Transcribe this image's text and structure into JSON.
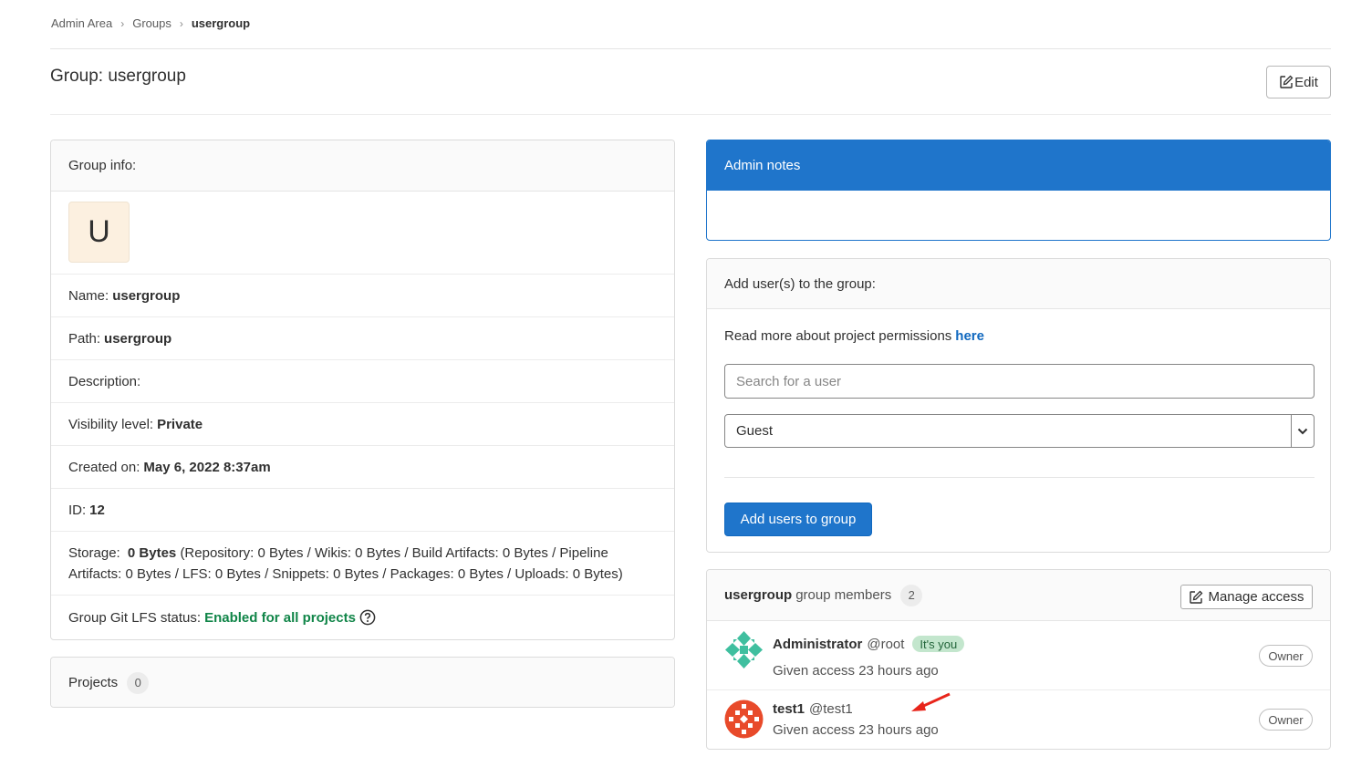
{
  "breadcrumb": {
    "items": [
      "Admin Area",
      "Groups"
    ],
    "current": "usergroup"
  },
  "header": {
    "title": "Group: usergroup",
    "edit_label": "Edit",
    "edit_icon": "pencil-square-icon"
  },
  "group_info": {
    "header": "Group info:",
    "avatar_letter": "U",
    "name_label": "Name:",
    "name_value": "usergroup",
    "path_label": "Path:",
    "path_value": "usergroup",
    "description_label": "Description:",
    "visibility_label": "Visibility level:",
    "visibility_value": "Private",
    "created_label": "Created on:",
    "created_value": "May 6, 2022 8:37am",
    "id_label": "ID:",
    "id_value": "12",
    "storage_label": "Storage:",
    "storage_value": "0 Bytes",
    "storage_detail": "(Repository: 0 Bytes / Wikis: 0 Bytes / Build Artifacts: 0 Bytes / Pipeline Artifacts: 0 Bytes / LFS: 0 Bytes / Snippets: 0 Bytes / Packages: 0 Bytes / Uploads: 0 Bytes)",
    "lfs_label": "Group Git LFS status:",
    "lfs_value": "Enabled for all projects"
  },
  "projects": {
    "label": "Projects",
    "count": "0"
  },
  "admin_notes": {
    "header": "Admin notes"
  },
  "add_users": {
    "header": "Add user(s) to the group:",
    "perm_text": "Read more about project permissions",
    "perm_link": "here",
    "search_placeholder": "Search for a user",
    "role_selected": "Guest",
    "button_label": "Add users to group"
  },
  "members": {
    "group_name": "usergroup",
    "header_suffix": "group members",
    "count": "2",
    "manage_label": "Manage access",
    "list": [
      {
        "name": "Administrator",
        "username": "@root",
        "badge": "It's you",
        "access": "Given access 23 hours ago",
        "role": "Owner"
      },
      {
        "name": "test1",
        "username": "@test1",
        "access": "Given access 23 hours ago",
        "role": "Owner"
      }
    ]
  },
  "colors": {
    "primary": "#1f75cb",
    "success": "#108548",
    "annotation_arrow": "#e8251b"
  }
}
